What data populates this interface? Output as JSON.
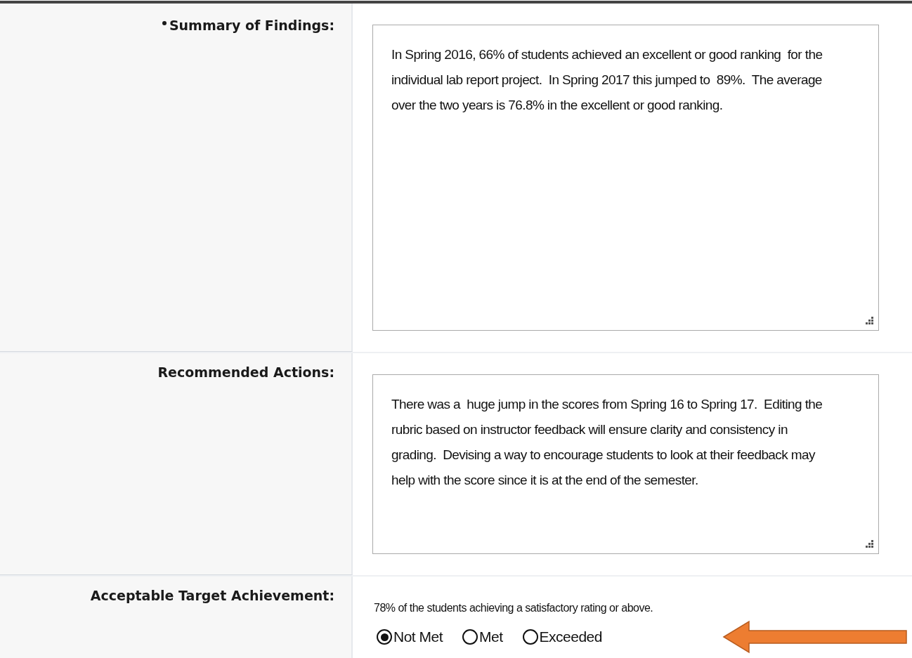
{
  "fields": [
    {
      "label": "Summary of Findings:",
      "required": true,
      "kind": "textarea",
      "value": "In Spring 2016, 66% of students achieved an excellent or good ranking  for the individual lab report project.  In Spring 2017 this jumped to  89%.  The average over the two years is 76.8% in the excellent or good ranking."
    },
    {
      "label": "Recommended Actions:",
      "required": false,
      "kind": "textarea",
      "value": "There was a  huge jump in the scores from Spring 16 to Spring 17.  Editing the rubric based on instructor feedback will ensure clarity and consistency in grading.  Devising a way to encourage students to look at their feedback may help with the score since it is at the end of the semester."
    },
    {
      "label": "Acceptable Target Achievement:",
      "required": false,
      "kind": "radio",
      "description": "78% of the students achieving a satisfactory rating or above.",
      "options": [
        {
          "label": "Not Met",
          "selected": true
        },
        {
          "label": "Met",
          "selected": false
        },
        {
          "label": "Exceeded",
          "selected": false
        }
      ]
    }
  ]
}
